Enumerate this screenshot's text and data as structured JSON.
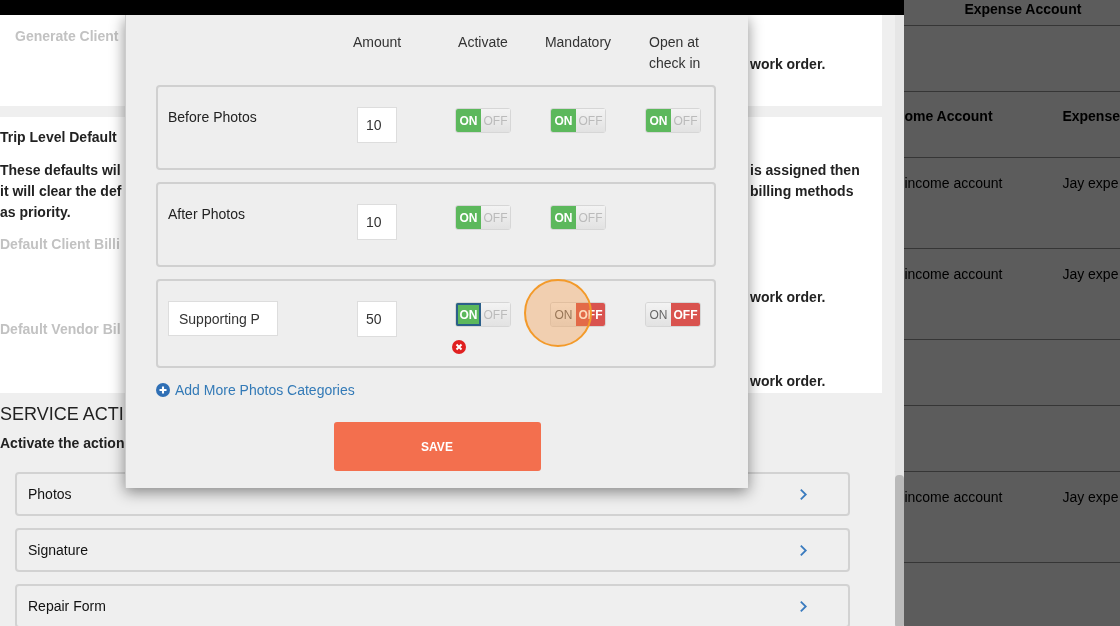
{
  "page": {
    "top_card": {
      "left_text": "Generate Client",
      "right_text": "work order."
    },
    "defaults_card": {
      "title": "Trip Level Default",
      "note_left": [
        "These defaults wil",
        "it will clear the def",
        "as priority."
      ],
      "note_right": [
        "is assigned then",
        "billing methods"
      ],
      "client_label": "Default Client Billi",
      "client_note": "work order.",
      "vendor_label": "Default Vendor Bil",
      "vendor_note": "work order."
    },
    "service_actions": {
      "title": "SERVICE ACTI",
      "subtitle": "Activate the action",
      "items": [
        "Photos",
        "Signature",
        "Repair Form"
      ]
    }
  },
  "accounts": {
    "top_header": "Expense Account",
    "columns": [
      "ome Account",
      "Expense"
    ],
    "rows": [
      {
        "kind": "data",
        "cells": [
          "income account",
          "Jay expe"
        ]
      },
      {
        "kind": "data",
        "cells": [
          "income account",
          "Jay expe"
        ]
      },
      {
        "kind": "empty"
      },
      {
        "kind": "empty"
      },
      {
        "kind": "data",
        "cells": [
          "income account",
          "Jay expe"
        ]
      }
    ]
  },
  "modal": {
    "columns": [
      "Amount",
      "Activate",
      "Mandatory",
      "Open at check in"
    ],
    "categories": [
      {
        "kind": "fixed",
        "name": "Before Photos",
        "amount": "10",
        "activate": {
          "on": true,
          "focused": false,
          "on_label": "ON",
          "off_label": "OFF"
        },
        "mandatory": {
          "on": true,
          "focused": false,
          "on_label": "ON",
          "off_label": "OFF"
        },
        "open_at_check_in": {
          "on": true,
          "focused": false,
          "on_label": "ON",
          "off_label": "OFF"
        }
      },
      {
        "kind": "fixed",
        "name": "After Photos",
        "amount": "10",
        "activate": {
          "on": true,
          "focused": false,
          "on_label": "ON",
          "off_label": "OFF"
        },
        "mandatory": {
          "on": true,
          "focused": false,
          "on_label": "ON",
          "off_label": "OFF"
        }
      },
      {
        "kind": "custom",
        "name": "Supporting P",
        "amount": "50",
        "error": true,
        "activate": {
          "on": true,
          "focused": true,
          "on_label": "ON",
          "off_label": "OFF"
        },
        "mandatory": {
          "on": false,
          "focused": false,
          "pointer_highlight": true,
          "on_label": "ON",
          "off_label": "OFF"
        },
        "open_at_check_in": {
          "on": false,
          "focused": false,
          "on_label": "ON",
          "off_label": "OFF"
        }
      }
    ],
    "add_link": "Add More Photos Categories",
    "save": "SAVE"
  }
}
